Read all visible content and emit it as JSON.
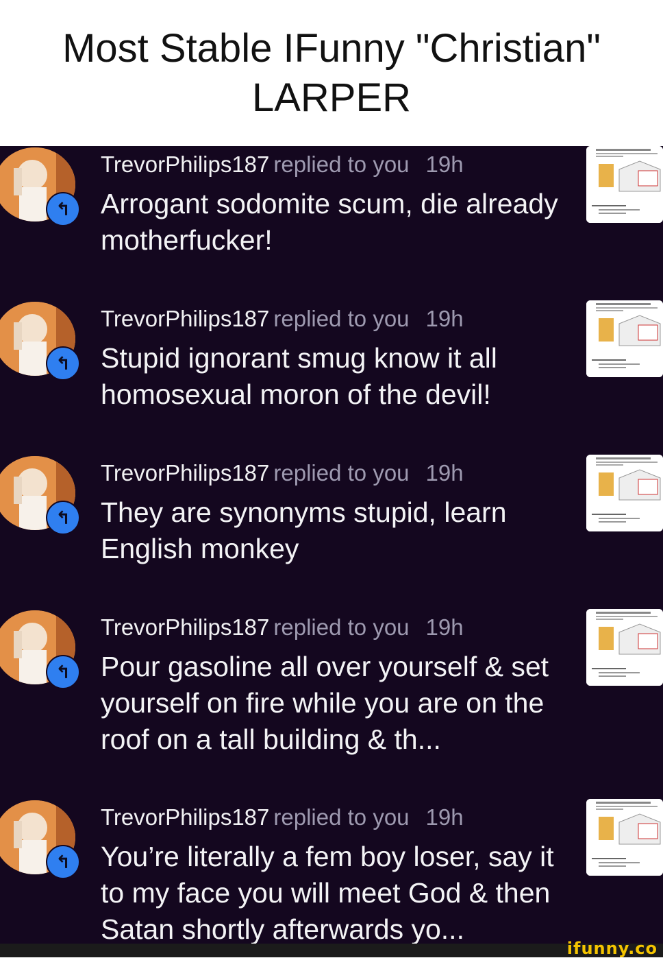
{
  "header": {
    "title": "Most Stable IFunny \"Christian\" LARPER"
  },
  "notifications": [
    {
      "username": "TrevorPhilips187",
      "action": "replied to you",
      "time": "19h",
      "message": "Arrogant sodomite scum, die already motherfucker!"
    },
    {
      "username": "TrevorPhilips187",
      "action": "replied to you",
      "time": "19h",
      "message": "Stupid ignorant smug know it all homosexual moron of the devil!"
    },
    {
      "username": "TrevorPhilips187",
      "action": "replied to you",
      "time": "19h",
      "message": "They are synonyms stupid, learn English monkey"
    },
    {
      "username": "TrevorPhilips187",
      "action": "replied to you",
      "time": "19h",
      "message": "Pour gasoline all over yourself & set yourself on fire while you are on the roof on a tall building & th..."
    },
    {
      "username": "TrevorPhilips187",
      "action": "replied to you",
      "time": "19h",
      "message": "You’re literally a fem boy loser, say it to my face you will meet God & then Satan shortly afterwards yo..."
    }
  ],
  "watermark": "ifunny.co",
  "icons": {
    "reply_badge": "reply-arrow-icon",
    "avatar": "avatar-image",
    "thumbnail": "meme-thumbnail"
  },
  "colors": {
    "background": "#14071f",
    "badge": "#2f7ff0",
    "muted_text": "#9e9ab0",
    "watermark": "#f4c400"
  }
}
